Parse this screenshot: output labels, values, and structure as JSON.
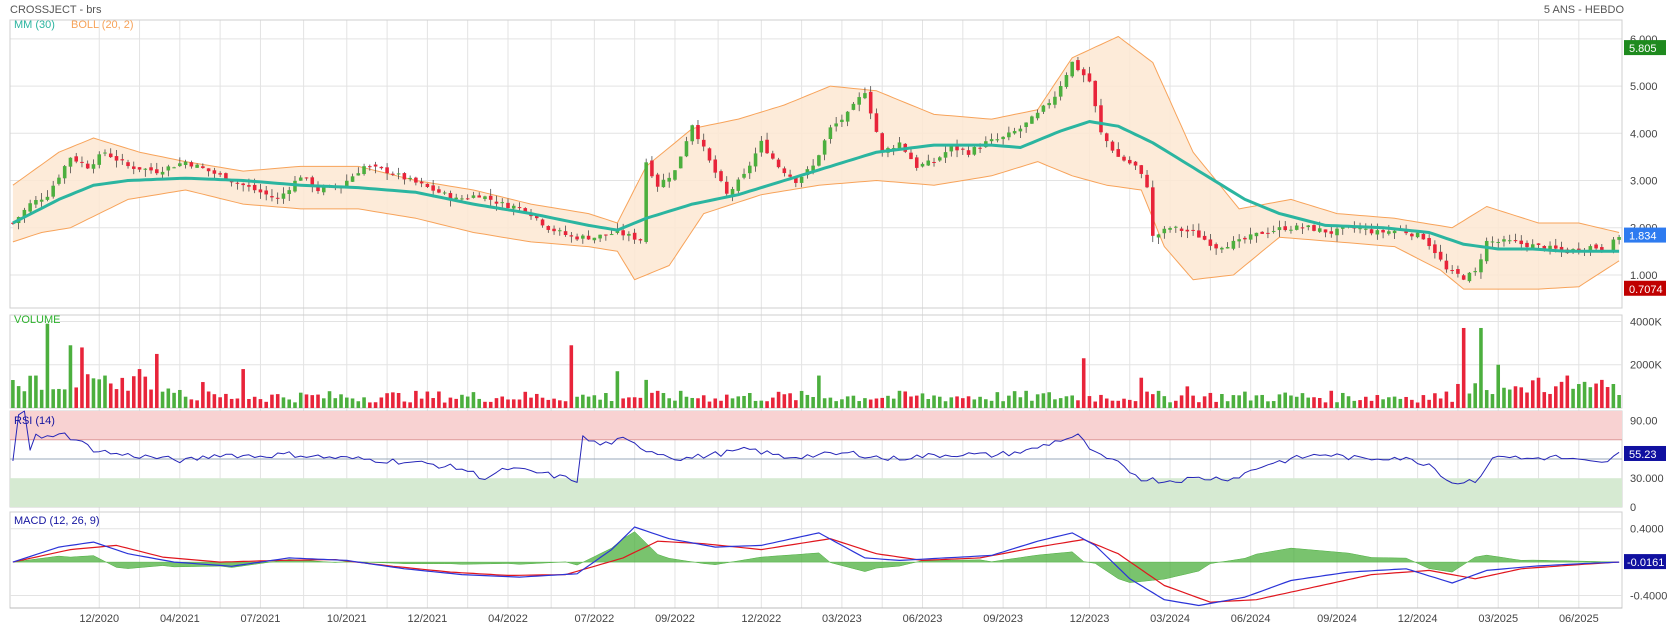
{
  "header": {
    "left_title": "CROSSJECT - brs",
    "right_title": "5 ANS - HEBDO"
  },
  "colors": {
    "up": "#4caf3e",
    "down": "#e8243a",
    "mm": "#2bb5a0",
    "boll": "#f7a35a",
    "boll_fill": "#fde8d2",
    "volume_label": "#2db22d",
    "rsi_label": "#1414a0",
    "rsi_line": "#2626b8",
    "macd_line": "#2b34d8",
    "signal_line": "#e0161e",
    "hist": "#4caf3e",
    "tag_last": "#2e7bf0",
    "tag_high": "#1e8a1e",
    "tag_low": "#c00000",
    "tag_rsi": "#1010a0",
    "tag_macd": "#1010a0"
  },
  "chart_data": [
    {
      "type": "candlestick",
      "panel": "price",
      "indicators": [
        {
          "label": "MM (30)",
          "color": "#2bb5a0"
        },
        {
          "label": "BOLL (20, 2)",
          "color": "#f7a35a"
        }
      ],
      "x_tick_labels": [
        "12/2020",
        "04/2021",
        "07/2021",
        "10/2021",
        "12/2021",
        "04/2022",
        "07/2022",
        "09/2022",
        "12/2022",
        "03/2023",
        "06/2023",
        "09/2023",
        "12/2023",
        "03/2024",
        "06/2024",
        "09/2024",
        "12/2024",
        "03/2025",
        "06/2025"
      ],
      "y_tick_labels": [
        "1.000",
        "2.000",
        "3.000",
        "4.000",
        "5.000",
        "6.000"
      ],
      "ylim": [
        0.3,
        6.4
      ],
      "tags": {
        "high": "5.805",
        "last": "1.834",
        "low": "0.7074"
      },
      "close_path": [
        [
          0,
          2.1
        ],
        [
          3,
          2.5
        ],
        [
          6,
          2.7
        ],
        [
          10,
          3.5
        ],
        [
          13,
          3.3
        ],
        [
          16,
          3.6
        ],
        [
          20,
          3.3
        ],
        [
          25,
          3.2
        ],
        [
          30,
          3.4
        ],
        [
          34,
          3.2
        ],
        [
          38,
          3.0
        ],
        [
          42,
          2.8
        ],
        [
          46,
          2.6
        ],
        [
          50,
          3.1
        ],
        [
          53,
          2.8
        ],
        [
          57,
          2.9
        ],
        [
          61,
          3.3
        ],
        [
          65,
          3.2
        ],
        [
          69,
          3.0
        ],
        [
          73,
          2.8
        ],
        [
          77,
          2.6
        ],
        [
          81,
          2.7
        ],
        [
          85,
          2.5
        ],
        [
          89,
          2.4
        ],
        [
          93,
          2.0
        ],
        [
          97,
          1.8
        ],
        [
          101,
          1.8
        ],
        [
          105,
          1.9
        ],
        [
          109,
          1.75
        ],
        [
          110,
          3.4
        ],
        [
          112,
          2.9
        ],
        [
          115,
          3.2
        ],
        [
          118,
          4.2
        ],
        [
          121,
          3.4
        ],
        [
          124,
          2.7
        ],
        [
          127,
          3.1
        ],
        [
          130,
          3.8
        ],
        [
          133,
          3.3
        ],
        [
          136,
          3.0
        ],
        [
          139,
          3.3
        ],
        [
          142,
          4.1
        ],
        [
          145,
          4.4
        ],
        [
          148,
          4.9
        ],
        [
          151,
          3.6
        ],
        [
          154,
          3.8
        ],
        [
          157,
          3.3
        ],
        [
          160,
          3.4
        ],
        [
          163,
          3.7
        ],
        [
          166,
          3.6
        ],
        [
          169,
          3.8
        ],
        [
          172,
          3.9
        ],
        [
          175,
          4.1
        ],
        [
          178,
          4.4
        ],
        [
          181,
          4.8
        ],
        [
          184,
          5.5
        ],
        [
          187,
          5.1
        ],
        [
          189,
          4.0
        ],
        [
          192,
          3.5
        ],
        [
          195,
          3.3
        ],
        [
          197,
          2.9
        ],
        [
          198,
          1.8
        ],
        [
          201,
          2.0
        ],
        [
          205,
          1.9
        ],
        [
          209,
          1.6
        ],
        [
          213,
          1.7
        ],
        [
          217,
          1.9
        ],
        [
          221,
          2.0
        ],
        [
          225,
          2.0
        ],
        [
          229,
          1.9
        ],
        [
          233,
          2.0
        ],
        [
          237,
          1.9
        ],
        [
          241,
          1.95
        ],
        [
          245,
          1.8
        ],
        [
          247,
          1.5
        ],
        [
          249,
          1.1
        ],
        [
          252,
          0.95
        ],
        [
          254,
          1.05
        ],
        [
          256,
          1.7
        ],
        [
          260,
          1.7
        ],
        [
          265,
          1.6
        ],
        [
          270,
          1.5
        ],
        [
          274,
          1.6
        ],
        [
          277,
          1.55
        ],
        [
          279,
          1.834
        ]
      ],
      "mm30_path": [
        [
          0,
          2.1
        ],
        [
          8,
          2.6
        ],
        [
          14,
          2.9
        ],
        [
          20,
          3.0
        ],
        [
          30,
          3.05
        ],
        [
          40,
          3.0
        ],
        [
          50,
          2.9
        ],
        [
          60,
          2.85
        ],
        [
          70,
          2.75
        ],
        [
          80,
          2.5
        ],
        [
          90,
          2.3
        ],
        [
          100,
          2.05
        ],
        [
          105,
          1.95
        ],
        [
          110,
          2.2
        ],
        [
          118,
          2.5
        ],
        [
          126,
          2.7
        ],
        [
          134,
          3.0
        ],
        [
          142,
          3.3
        ],
        [
          150,
          3.6
        ],
        [
          160,
          3.75
        ],
        [
          170,
          3.75
        ],
        [
          175,
          3.7
        ],
        [
          182,
          4.05
        ],
        [
          187,
          4.25
        ],
        [
          192,
          4.15
        ],
        [
          198,
          3.8
        ],
        [
          206,
          3.2
        ],
        [
          214,
          2.6
        ],
        [
          220,
          2.3
        ],
        [
          228,
          2.05
        ],
        [
          238,
          2.0
        ],
        [
          246,
          1.9
        ],
        [
          252,
          1.65
        ],
        [
          258,
          1.55
        ],
        [
          264,
          1.55
        ],
        [
          270,
          1.5
        ],
        [
          279,
          1.5
        ]
      ],
      "boll_upper_path": [
        [
          0,
          2.9
        ],
        [
          8,
          3.6
        ],
        [
          14,
          3.9
        ],
        [
          22,
          3.6
        ],
        [
          30,
          3.4
        ],
        [
          40,
          3.2
        ],
        [
          50,
          3.3
        ],
        [
          60,
          3.3
        ],
        [
          70,
          3.0
        ],
        [
          80,
          2.8
        ],
        [
          90,
          2.5
        ],
        [
          100,
          2.3
        ],
        [
          105,
          2.1
        ],
        [
          110,
          3.3
        ],
        [
          118,
          4.1
        ],
        [
          126,
          4.3
        ],
        [
          134,
          4.6
        ],
        [
          142,
          5.0
        ],
        [
          150,
          4.9
        ],
        [
          160,
          4.4
        ],
        [
          170,
          4.3
        ],
        [
          178,
          4.5
        ],
        [
          184,
          5.6
        ],
        [
          192,
          6.05
        ],
        [
          198,
          5.5
        ],
        [
          205,
          3.6
        ],
        [
          213,
          2.4
        ],
        [
          222,
          2.6
        ],
        [
          230,
          2.3
        ],
        [
          240,
          2.2
        ],
        [
          250,
          2.0
        ],
        [
          256,
          2.45
        ],
        [
          265,
          2.1
        ],
        [
          272,
          2.1
        ],
        [
          279,
          1.9
        ]
      ],
      "boll_lower_path": [
        [
          0,
          1.7
        ],
        [
          5,
          1.9
        ],
        [
          10,
          2.0
        ],
        [
          20,
          2.6
        ],
        [
          30,
          2.8
        ],
        [
          40,
          2.5
        ],
        [
          50,
          2.4
        ],
        [
          60,
          2.4
        ],
        [
          70,
          2.2
        ],
        [
          80,
          1.9
        ],
        [
          90,
          1.7
        ],
        [
          100,
          1.6
        ],
        [
          105,
          1.5
        ],
        [
          108,
          0.9
        ],
        [
          114,
          1.2
        ],
        [
          120,
          2.3
        ],
        [
          130,
          2.7
        ],
        [
          140,
          2.9
        ],
        [
          150,
          3.0
        ],
        [
          160,
          2.9
        ],
        [
          170,
          3.1
        ],
        [
          178,
          3.4
        ],
        [
          184,
          3.1
        ],
        [
          190,
          2.9
        ],
        [
          196,
          2.8
        ],
        [
          200,
          1.6
        ],
        [
          205,
          0.9
        ],
        [
          212,
          1.0
        ],
        [
          220,
          1.8
        ],
        [
          230,
          1.7
        ],
        [
          240,
          1.6
        ],
        [
          248,
          1.1
        ],
        [
          252,
          0.7
        ],
        [
          256,
          0.7
        ],
        [
          265,
          0.7
        ],
        [
          272,
          0.75
        ],
        [
          279,
          1.3
        ]
      ]
    },
    {
      "type": "bar",
      "panel": "volume",
      "title": "VOLUME",
      "y_tick_labels": [
        "2000K",
        "4000K"
      ],
      "ylim": [
        0,
        4300
      ],
      "unit": "K",
      "spikes": [
        [
          4,
          1500
        ],
        [
          6,
          3900
        ],
        [
          10,
          2900
        ],
        [
          12,
          2800
        ],
        [
          16,
          1500
        ],
        [
          22,
          1800
        ],
        [
          25,
          2500
        ],
        [
          33,
          1200
        ],
        [
          40,
          1800
        ],
        [
          97,
          2900
        ],
        [
          105,
          1700
        ],
        [
          110,
          1300
        ],
        [
          140,
          1500
        ],
        [
          186,
          2300
        ],
        [
          196,
          1400
        ],
        [
          204,
          1000
        ],
        [
          252,
          3700
        ],
        [
          255,
          3700
        ],
        [
          258,
          2000
        ],
        [
          265,
          1400
        ],
        [
          270,
          1500
        ],
        [
          276,
          1300
        ]
      ]
    },
    {
      "type": "line",
      "panel": "rsi",
      "title": "RSI (14)",
      "y_tick_labels": [
        "90.00",
        "30.000",
        "0"
      ],
      "ylim": [
        0,
        100
      ],
      "overbought": 70,
      "oversold": 30,
      "tag": "55.23",
      "path": [
        [
          0,
          50
        ],
        [
          1,
          98
        ],
        [
          2,
          98
        ],
        [
          3,
          60
        ],
        [
          4,
          75
        ],
        [
          5,
          70
        ],
        [
          8,
          78
        ],
        [
          11,
          70
        ],
        [
          14,
          60
        ],
        [
          18,
          55
        ],
        [
          24,
          52
        ],
        [
          30,
          48
        ],
        [
          36,
          55
        ],
        [
          42,
          53
        ],
        [
          48,
          55
        ],
        [
          54,
          52
        ],
        [
          60,
          50
        ],
        [
          66,
          48
        ],
        [
          72,
          45
        ],
        [
          78,
          40
        ],
        [
          82,
          30
        ],
        [
          86,
          40
        ],
        [
          92,
          35
        ],
        [
          96,
          30
        ],
        [
          98,
          28
        ],
        [
          99,
          72
        ],
        [
          102,
          65
        ],
        [
          106,
          70
        ],
        [
          110,
          60
        ],
        [
          116,
          50
        ],
        [
          122,
          55
        ],
        [
          128,
          60
        ],
        [
          134,
          52
        ],
        [
          140,
          54
        ],
        [
          146,
          56
        ],
        [
          152,
          50
        ],
        [
          158,
          53
        ],
        [
          164,
          55
        ],
        [
          170,
          54
        ],
        [
          176,
          58
        ],
        [
          182,
          70
        ],
        [
          185,
          74
        ],
        [
          188,
          55
        ],
        [
          192,
          45
        ],
        [
          196,
          30
        ],
        [
          200,
          27
        ],
        [
          206,
          30
        ],
        [
          212,
          30
        ],
        [
          218,
          45
        ],
        [
          224,
          52
        ],
        [
          228,
          55
        ],
        [
          234,
          50
        ],
        [
          240,
          52
        ],
        [
          246,
          45
        ],
        [
          250,
          25
        ],
        [
          254,
          28
        ],
        [
          258,
          55
        ],
        [
          262,
          50
        ],
        [
          268,
          52
        ],
        [
          272,
          48
        ],
        [
          276,
          45
        ],
        [
          279,
          55
        ]
      ]
    },
    {
      "type": "line",
      "panel": "macd",
      "title": "MACD (12, 26, 9)",
      "y_tick_labels": [
        "0.4000",
        "-0.4000"
      ],
      "ylim": [
        -0.55,
        0.6
      ],
      "tag": "-0.0161",
      "macd_path": [
        [
          0,
          0
        ],
        [
          8,
          0.18
        ],
        [
          14,
          0.24
        ],
        [
          20,
          0.1
        ],
        [
          28,
          0.0
        ],
        [
          38,
          -0.05
        ],
        [
          48,
          0.05
        ],
        [
          58,
          0.02
        ],
        [
          68,
          -0.08
        ],
        [
          78,
          -0.15
        ],
        [
          88,
          -0.18
        ],
        [
          98,
          -0.14
        ],
        [
          104,
          0.15
        ],
        [
          108,
          0.42
        ],
        [
          114,
          0.28
        ],
        [
          122,
          0.18
        ],
        [
          130,
          0.2
        ],
        [
          140,
          0.35
        ],
        [
          148,
          0.05
        ],
        [
          154,
          0.02
        ],
        [
          162,
          0.05
        ],
        [
          170,
          0.08
        ],
        [
          178,
          0.25
        ],
        [
          184,
          0.35
        ],
        [
          188,
          0.2
        ],
        [
          194,
          -0.2
        ],
        [
          200,
          -0.45
        ],
        [
          206,
          -0.52
        ],
        [
          214,
          -0.42
        ],
        [
          222,
          -0.22
        ],
        [
          232,
          -0.12
        ],
        [
          242,
          -0.08
        ],
        [
          250,
          -0.25
        ],
        [
          256,
          -0.1
        ],
        [
          264,
          -0.05
        ],
        [
          272,
          -0.02
        ],
        [
          279,
          0.0
        ]
      ],
      "signal_path": [
        [
          0,
          0
        ],
        [
          10,
          0.15
        ],
        [
          18,
          0.2
        ],
        [
          26,
          0.06
        ],
        [
          36,
          0.0
        ],
        [
          46,
          0.02
        ],
        [
          56,
          0.03
        ],
        [
          66,
          -0.05
        ],
        [
          76,
          -0.12
        ],
        [
          86,
          -0.16
        ],
        [
          96,
          -0.15
        ],
        [
          106,
          0.05
        ],
        [
          112,
          0.25
        ],
        [
          120,
          0.22
        ],
        [
          130,
          0.15
        ],
        [
          142,
          0.28
        ],
        [
          150,
          0.1
        ],
        [
          158,
          0.02
        ],
        [
          168,
          0.05
        ],
        [
          178,
          0.18
        ],
        [
          186,
          0.27
        ],
        [
          192,
          0.1
        ],
        [
          200,
          -0.28
        ],
        [
          208,
          -0.48
        ],
        [
          216,
          -0.45
        ],
        [
          226,
          -0.3
        ],
        [
          236,
          -0.15
        ],
        [
          246,
          -0.1
        ],
        [
          254,
          -0.2
        ],
        [
          262,
          -0.08
        ],
        [
          272,
          -0.03
        ],
        [
          279,
          0.0
        ]
      ]
    }
  ]
}
